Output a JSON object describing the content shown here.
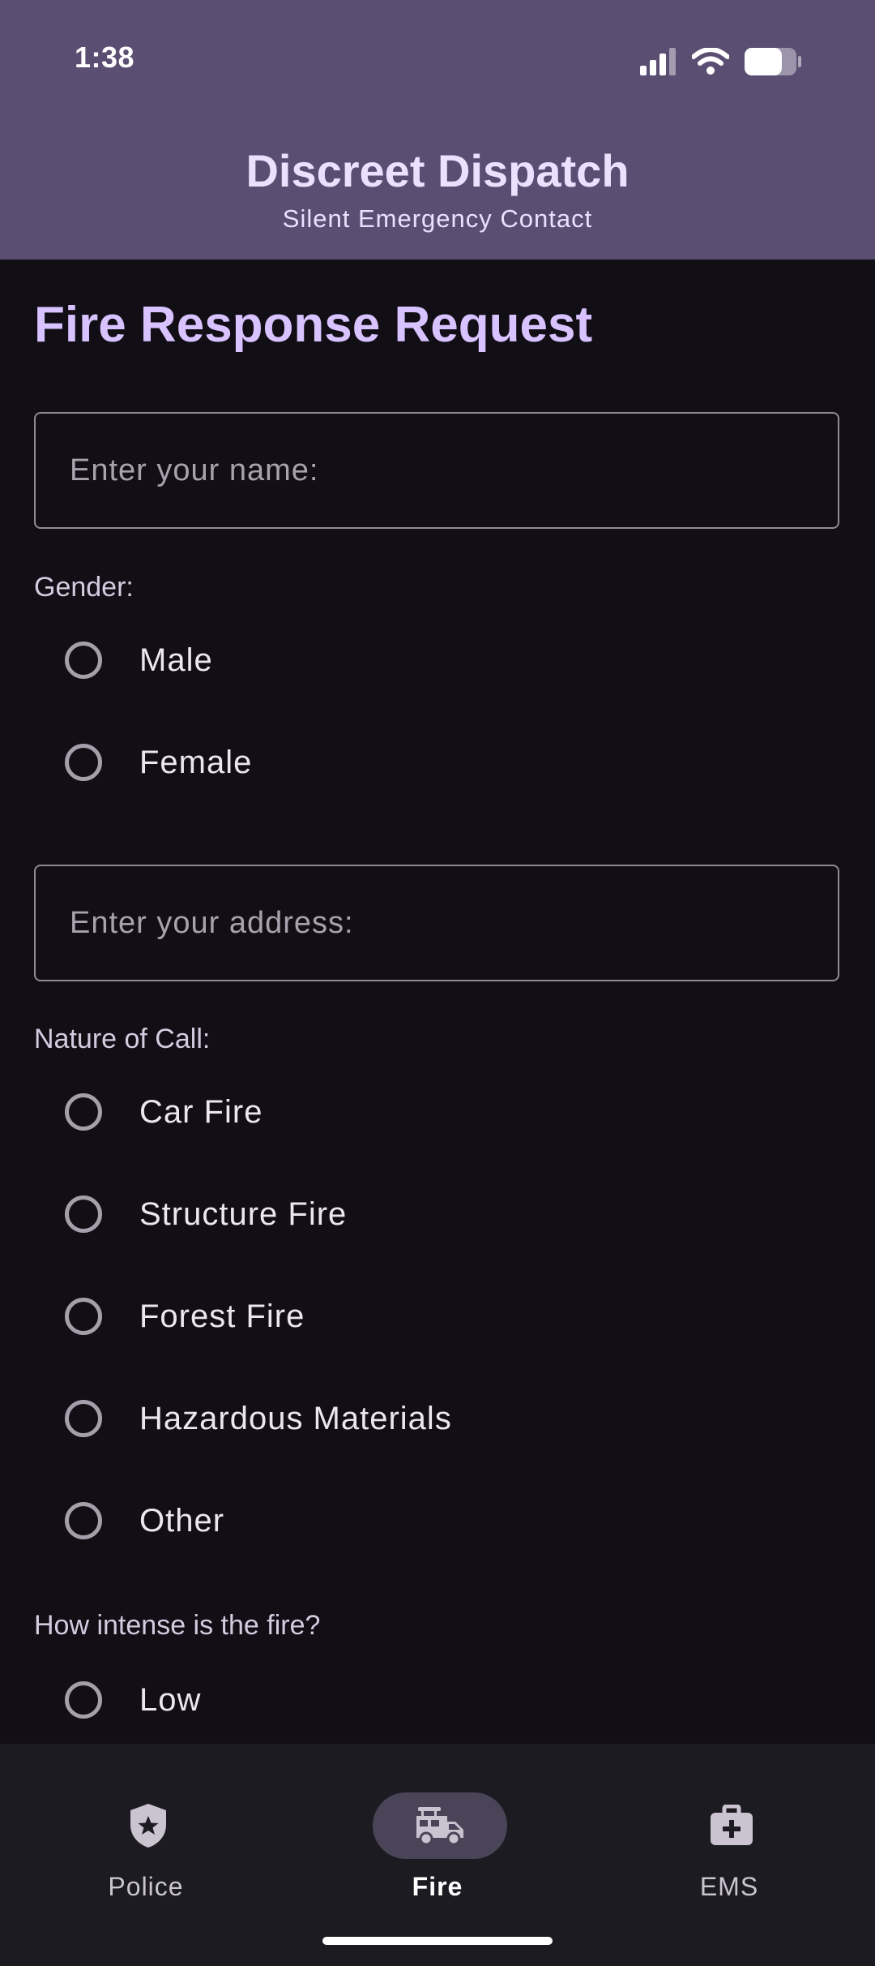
{
  "status_bar": {
    "time": "1:38",
    "icons": [
      "cellular-signal-icon",
      "wifi-icon",
      "battery-icon"
    ]
  },
  "header": {
    "title": "Discreet Dispatch",
    "subtitle": "Silent Emergency Contact"
  },
  "form": {
    "title": "Fire Response Request",
    "name_field": {
      "placeholder": "Enter your name:",
      "value": ""
    },
    "gender": {
      "label": "Gender:",
      "options": [
        "Male",
        "Female"
      ],
      "selected": null
    },
    "address_field": {
      "placeholder": "Enter your address:",
      "value": ""
    },
    "nature": {
      "label": "Nature of Call:",
      "options": [
        "Car Fire",
        "Structure Fire",
        "Forest Fire",
        "Hazardous Materials",
        "Other"
      ],
      "selected": null
    },
    "intensity": {
      "label": "How intense is the fire?",
      "options": [
        "Low"
      ],
      "selected": null
    }
  },
  "bottom_nav": {
    "items": [
      {
        "label": "Police",
        "icon": "police-shield-icon",
        "active": false
      },
      {
        "label": "Fire",
        "icon": "fire-truck-icon",
        "active": true
      },
      {
        "label": "EMS",
        "icon": "medical-kit-icon",
        "active": false
      }
    ]
  },
  "colors": {
    "header_bg": "#5a4e73",
    "page_bg": "#110f15",
    "accent_title": "#d8c2ff",
    "nav_bg": "#1d1b22",
    "nav_active_pill": "#4a4458"
  }
}
